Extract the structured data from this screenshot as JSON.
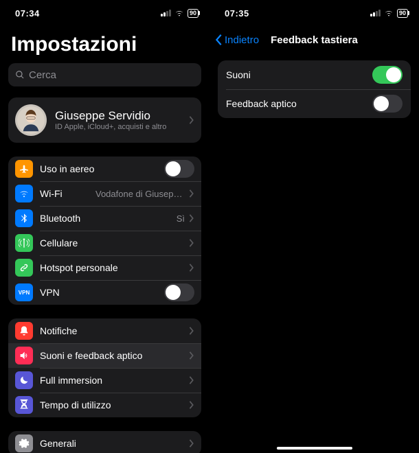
{
  "left": {
    "status": {
      "time": "07:34",
      "battery": "90"
    },
    "title": "Impostazioni",
    "search_placeholder": "Cerca",
    "profile": {
      "name": "Giuseppe Servidio",
      "subtitle": "ID Apple, iCloud+, acquisti e altro"
    },
    "groups": [
      {
        "rows": [
          {
            "icon": "airplane-icon",
            "bg": "bg-orange",
            "label": "Uso in aereo",
            "control": "toggle",
            "on": false
          },
          {
            "icon": "wifi-icon",
            "bg": "bg-blue",
            "label": "Wi-Fi",
            "detail": "Vodafone di Giuseppe e Sara",
            "control": "disclosure"
          },
          {
            "icon": "bluetooth-icon",
            "bg": "bg-blue",
            "label": "Bluetooth",
            "detail": "Sì",
            "control": "disclosure"
          },
          {
            "icon": "antenna-icon",
            "bg": "bg-green",
            "label": "Cellulare",
            "control": "disclosure"
          },
          {
            "icon": "link-icon",
            "bg": "bg-greenlink",
            "label": "Hotspot personale",
            "control": "disclosure"
          },
          {
            "icon": "vpn-icon",
            "bg": "bg-bluevpn",
            "label": "VPN",
            "control": "toggle",
            "on": false,
            "vpnText": "VPN"
          }
        ]
      },
      {
        "rows": [
          {
            "icon": "bell-icon",
            "bg": "bg-red",
            "label": "Notifiche",
            "control": "disclosure"
          },
          {
            "icon": "speaker-icon",
            "bg": "bg-pink",
            "label": "Suoni e feedback aptico",
            "control": "disclosure",
            "highlight": true
          },
          {
            "icon": "moon-icon",
            "bg": "bg-indigo",
            "label": "Full immersion",
            "control": "disclosure"
          },
          {
            "icon": "hourglass-icon",
            "bg": "bg-indigo",
            "label": "Tempo di utilizzo",
            "control": "disclosure"
          }
        ]
      },
      {
        "rows": [
          {
            "icon": "gear-icon",
            "bg": "bg-gray",
            "label": "Generali",
            "control": "disclosure"
          }
        ]
      }
    ]
  },
  "right": {
    "status": {
      "time": "07:35",
      "battery": "90"
    },
    "back": "Indietro",
    "title": "Feedback tastiera",
    "rows": [
      {
        "label": "Suoni",
        "on": true
      },
      {
        "label": "Feedback aptico",
        "on": false
      }
    ]
  }
}
